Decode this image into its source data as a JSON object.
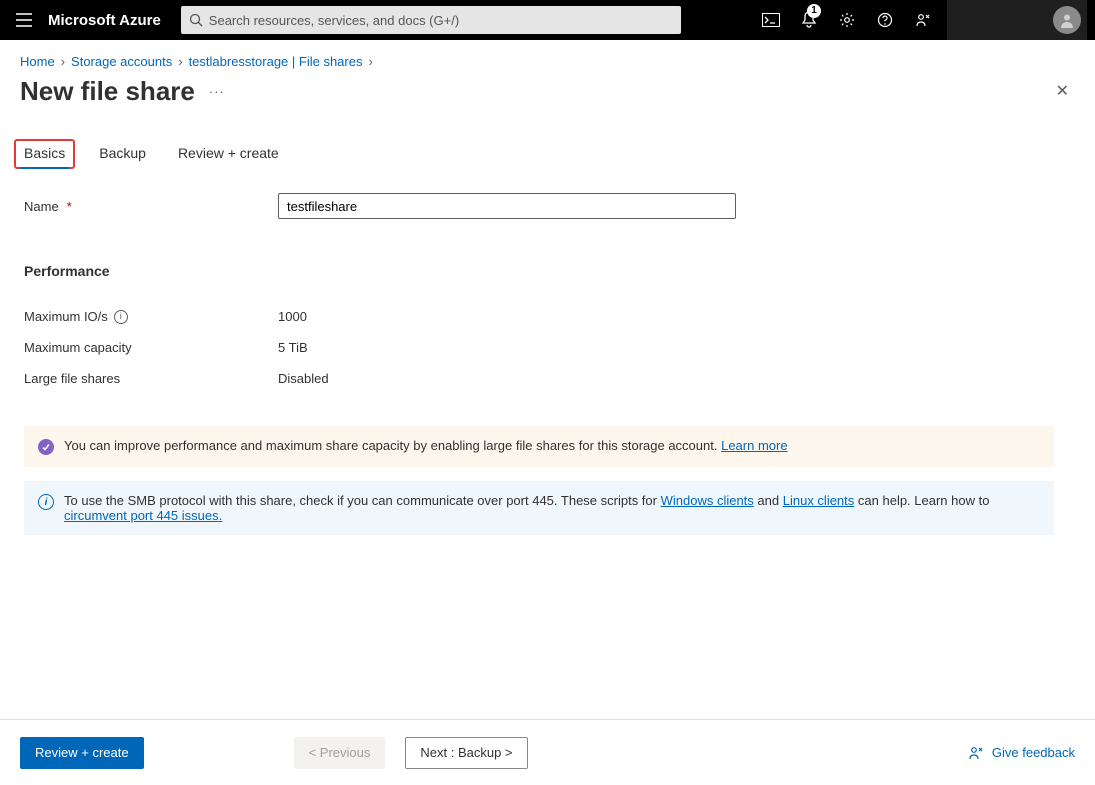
{
  "header": {
    "brand": "Microsoft Azure",
    "search_placeholder": "Search resources, services, and docs (G+/)",
    "notification_count": "1"
  },
  "breadcrumb": {
    "items": [
      "Home",
      "Storage accounts",
      "testlabresstorage | File shares"
    ]
  },
  "page": {
    "title": "New file share"
  },
  "tabs": [
    {
      "label": "Basics"
    },
    {
      "label": "Backup"
    },
    {
      "label": "Review + create"
    }
  ],
  "form": {
    "name_label": "Name",
    "name_value": "testfileshare"
  },
  "performance": {
    "heading": "Performance",
    "rows": [
      {
        "label": "Maximum IO/s",
        "value": "1000",
        "info": true
      },
      {
        "label": "Maximum capacity",
        "value": "5 TiB",
        "info": false
      },
      {
        "label": "Large file shares",
        "value": "Disabled",
        "info": false
      }
    ]
  },
  "banners": {
    "tip_text": "You can improve performance and maximum share capacity by enabling large file shares for this storage account. ",
    "tip_link": "Learn more",
    "info_pre": "To use the SMB protocol with this share, check if you can communicate over port 445. These scripts for ",
    "info_link1": "Windows clients",
    "info_mid": " and ",
    "info_link2": "Linux clients",
    "info_post": " can help. Learn how to ",
    "info_link3": "circumvent port 445 issues."
  },
  "footer": {
    "review": "Review + create",
    "previous": "< Previous",
    "next": "Next : Backup >",
    "feedback": "Give feedback"
  }
}
